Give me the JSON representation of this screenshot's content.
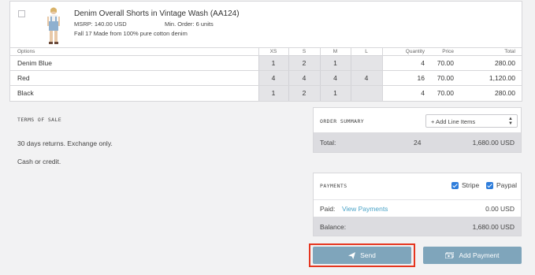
{
  "product": {
    "title": "Denim Overall Shorts in Vintage Wash (AA124)",
    "msrp": "MSRP: 140.00 USD",
    "min_order": "Min. Order: 6 units",
    "description": "Fall 17 Made from 100% pure cotton denim"
  },
  "grid": {
    "headers": {
      "options": "Options",
      "xs": "XS",
      "s": "S",
      "m": "M",
      "l": "L",
      "quantity": "Quantity",
      "price": "Price",
      "total": "Total"
    },
    "rows": [
      {
        "option": "Denim Blue",
        "xs": "1",
        "s": "2",
        "m": "1",
        "l": "",
        "quantity": "4",
        "price": "70.00",
        "total": "280.00"
      },
      {
        "option": "Red",
        "xs": "4",
        "s": "4",
        "m": "4",
        "l": "4",
        "quantity": "16",
        "price": "70.00",
        "total": "1,120.00"
      },
      {
        "option": "Black",
        "xs": "1",
        "s": "2",
        "m": "1",
        "l": "",
        "quantity": "4",
        "price": "70.00",
        "total": "280.00"
      }
    ]
  },
  "terms": {
    "title": "TERMS OF SALE",
    "line1": "30 days returns. Exchange only.",
    "line2": "Cash or credit."
  },
  "order_summary": {
    "title": "ORDER SUMMARY",
    "select_value": "+ Add Line Items",
    "total_label": "Total:",
    "total_qty": "24",
    "total_amount": "1,680.00 USD"
  },
  "payments": {
    "title": "PAYMENTS",
    "stripe_label": "Stripe",
    "paypal_label": "Paypal",
    "paid_label": "Paid:",
    "view_payments": "View Payments",
    "paid_amount": "0.00 USD",
    "balance_label": "Balance:",
    "balance_amount": "1,680.00 USD"
  },
  "buttons": {
    "send": "Send",
    "add_payment": "Add Payment"
  },
  "colors": {
    "button": "#7fa5bb",
    "highlight": "#e5351f",
    "link": "#4aa3c7",
    "checkbox": "#2e7ddb"
  }
}
